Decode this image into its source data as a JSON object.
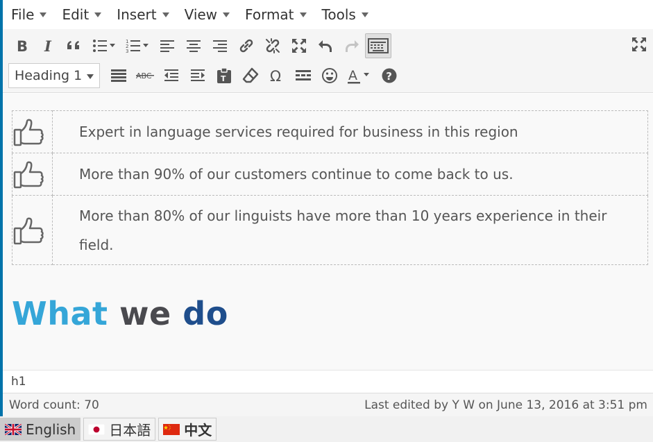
{
  "menubar": {
    "items": [
      "File",
      "Edit",
      "Insert",
      "View",
      "Format",
      "Tools"
    ]
  },
  "toolbar": {
    "format_select": "Heading 1",
    "row1_icons": [
      "bold-icon",
      "italic-icon",
      "blockquote-icon",
      "bullet-list-icon",
      "numbered-list-icon",
      "align-left-icon",
      "align-center-icon",
      "align-right-icon",
      "link-icon",
      "unlink-icon",
      "fullscreen-icon",
      "undo-icon",
      "redo-icon",
      "toolbar-toggle-icon"
    ],
    "row2_icons": [
      "justify-icon",
      "strikethrough-icon",
      "outdent-icon",
      "indent-icon",
      "paste-text-icon",
      "clear-formatting-icon",
      "special-character-icon",
      "horizontal-line-icon",
      "emoticon-icon",
      "text-color-icon",
      "help-icon"
    ],
    "bold_glyph": "B",
    "italic_glyph": "I",
    "strike_glyph": "ABC",
    "omega_glyph": "Ω",
    "text_color_glyph": "A",
    "help_glyph": "?"
  },
  "content": {
    "features": [
      {
        "icon": "thumbs-up-icon",
        "text": "Expert in language services required for business in this region"
      },
      {
        "icon": "thumbs-up-icon",
        "text": "More than 90% of our customers continue to come back to us."
      },
      {
        "icon": "thumbs-up-icon",
        "text": "More than 80% of our linguists have more than 10 years experience in their field."
      }
    ],
    "heading": {
      "word1": "What",
      "word2": "we",
      "word3": "do"
    }
  },
  "colors": {
    "heading_word1": "#35a6d8",
    "heading_word2": "#4a4a4f",
    "heading_word3": "#1f4e8c",
    "accent": "#0073aa"
  },
  "pathbar": {
    "path": "h1"
  },
  "statusbar": {
    "word_count": "Word count: 70",
    "last_edited": "Last edited by Y W on June 13, 2016 at 3:51 pm"
  },
  "languages": [
    {
      "label": "English",
      "flag": "uk-flag-icon",
      "active": true
    },
    {
      "label": "日本語",
      "flag": "japan-flag-icon",
      "active": false
    },
    {
      "label": "中文",
      "flag": "china-flag-icon",
      "active": false
    }
  ]
}
